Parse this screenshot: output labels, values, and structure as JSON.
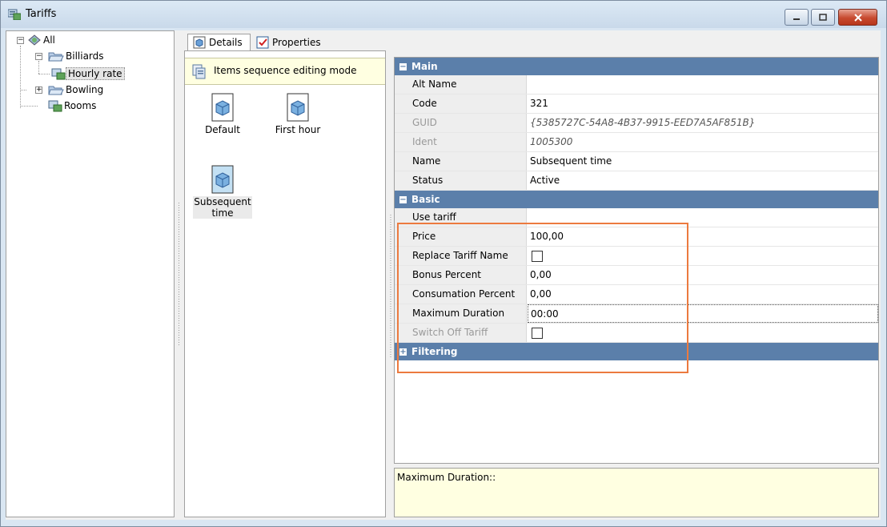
{
  "window": {
    "title": "Tariffs",
    "icon": "tariffs-icon",
    "minimize_icon": "minimize-icon",
    "maximize_icon": "maximize-icon",
    "close_icon": "close-icon"
  },
  "tree": {
    "nodes": [
      {
        "label": "All",
        "icon": "globe-folder-icon",
        "expander": "−"
      },
      {
        "label": "Billiards",
        "icon": "open-folder-icon",
        "expander": "−"
      },
      {
        "label": "Hourly rate",
        "icon": "tariff-icon",
        "selected": true
      },
      {
        "label": "Bowling",
        "icon": "open-folder-icon",
        "expander": "+"
      },
      {
        "label": "Rooms",
        "icon": "tariff-icon"
      }
    ]
  },
  "tabs": [
    {
      "label": "Details",
      "icon": "details-icon",
      "active": true
    },
    {
      "label": "Properties",
      "icon": "properties-icon",
      "active": false
    }
  ],
  "sequence_bar": {
    "label": "Items sequence editing mode",
    "icon": "sequence-icon"
  },
  "items": [
    {
      "label": "Default",
      "icon": "cube-document-icon"
    },
    {
      "label": "First hour",
      "icon": "cube-document-icon"
    },
    {
      "label": "Subsequent time",
      "icon": "cube-document-icon",
      "selected": true
    }
  ],
  "property_grid": {
    "categories": {
      "main": {
        "label": "Main",
        "expander": "−"
      },
      "basic": {
        "label": "Basic",
        "expander": "−"
      },
      "filtering": {
        "label": "Filtering",
        "expander": "+"
      }
    },
    "main_rows": [
      {
        "name": "Alt Name",
        "value": ""
      },
      {
        "name": "Code",
        "value": "321"
      },
      {
        "name": "GUID",
        "value": "{5385727C-54A8-4B37-9915-EED7A5AF851B}",
        "disabled": true
      },
      {
        "name": "Ident",
        "value": "1005300",
        "disabled": true
      },
      {
        "name": "Name",
        "value": "Subsequent time"
      },
      {
        "name": "Status",
        "value": "Active"
      }
    ],
    "basic_rows": [
      {
        "name": "Use tariff",
        "value": ""
      },
      {
        "name": "Price",
        "value": "100,00"
      },
      {
        "name": "Replace Tariff Name",
        "value": "",
        "checkbox": true,
        "checked": false
      },
      {
        "name": "Bonus Percent",
        "value": "0,00"
      },
      {
        "name": "Consumation Percent",
        "value": "0,00"
      },
      {
        "name": "Maximum Duration",
        "value": "00:00",
        "focused": true
      },
      {
        "name": "Switch Off Tariff",
        "value": "",
        "checkbox": true,
        "checked": false,
        "disabled": true
      }
    ]
  },
  "description": {
    "text": "Maximum Duration::"
  },
  "colors": {
    "category_header": "#5b7faa",
    "highlight": "#ec7a3f",
    "info_bg": "#ffffe1"
  }
}
